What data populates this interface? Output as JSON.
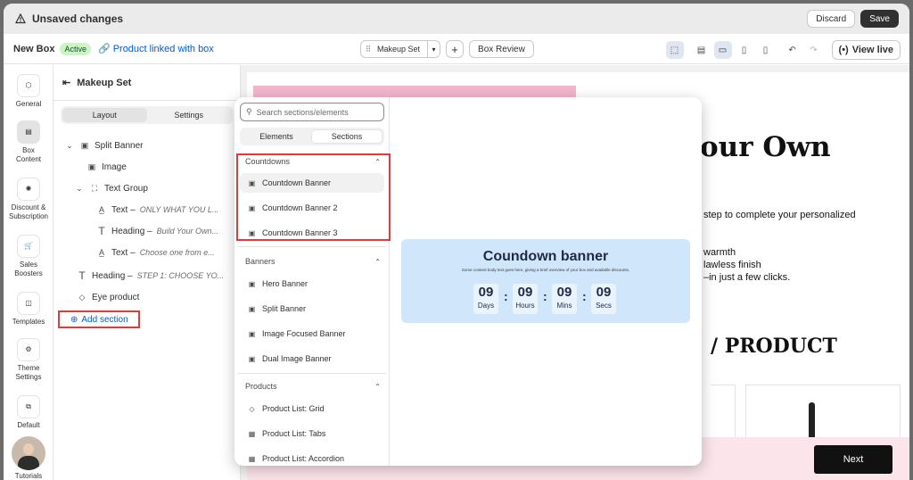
{
  "topbar": {
    "title": "Unsaved changes",
    "discard": "Discard",
    "save": "Save"
  },
  "subbar": {
    "box_name": "New Box",
    "status": "Active",
    "link": "Product linked with box",
    "set_select": "Makeup Set",
    "box_review": "Box Review",
    "view_live": "View live"
  },
  "rail": [
    {
      "label": "General",
      "icon": "cube-icon"
    },
    {
      "label": "Box Content",
      "icon": "layers-icon"
    },
    {
      "label": "Discount & Subscription",
      "icon": "discount-icon"
    },
    {
      "label": "Sales Boosters",
      "icon": "cart-icon"
    },
    {
      "label": "Templates",
      "icon": "template-icon"
    },
    {
      "label": "Theme Settings",
      "icon": "gear-icon"
    },
    {
      "label": "Default",
      "icon": "box-icon"
    },
    {
      "label": "Tutorials",
      "icon": "avatar"
    }
  ],
  "side": {
    "title": "Makeup Set",
    "tab_layout": "Layout",
    "tab_settings": "Settings",
    "tree": [
      {
        "label": "Split Banner",
        "sub": ""
      },
      {
        "label": "Image",
        "sub": ""
      },
      {
        "label": "Text Group",
        "sub": ""
      },
      {
        "label": "Text –",
        "sub": "ONLY WHAT YOU L..."
      },
      {
        "label": "Heading –",
        "sub": "Build Your Own..."
      },
      {
        "label": "Text –",
        "sub": "Choose one from e..."
      },
      {
        "label": "Heading –",
        "sub": "STEP 1: CHOOSE YO..."
      },
      {
        "label": "Eye product",
        "sub": ""
      }
    ],
    "add_section": "Add section"
  },
  "popup": {
    "search_placeholder": "Search sections/elements",
    "tab_elements": "Elements",
    "tab_sections": "Sections",
    "groups": [
      {
        "title": "Countdowns",
        "items": [
          "Countdown Banner",
          "Countdown Banner 2",
          "Countdown Banner 3"
        ]
      },
      {
        "title": "Banners",
        "items": [
          "Hero Banner",
          "Split Banner",
          "Image Focused Banner",
          "Dual Image Banner"
        ]
      },
      {
        "title": "Products",
        "items": [
          "Product List: Grid",
          "Product List: Tabs",
          "Product List: Accordion"
        ]
      }
    ],
    "banner": {
      "title": "Coundown banner",
      "subtitle": "Some content body text goes here, giving a brief overview of your box and available discounts.",
      "units": [
        {
          "n": "09",
          "u": "Days"
        },
        {
          "n": "09",
          "u": "Hours"
        },
        {
          "n": "09",
          "u": "Mins"
        },
        {
          "n": "09",
          "u": "Secs"
        }
      ]
    }
  },
  "preview": {
    "heading": "our Own",
    "line1": "step to complete your personalized",
    "line2": "warmth",
    "line3": "lawless finish",
    "line4": "–in just a few clicks.",
    "heading2": "/ PRODUCT",
    "next": "Next"
  }
}
